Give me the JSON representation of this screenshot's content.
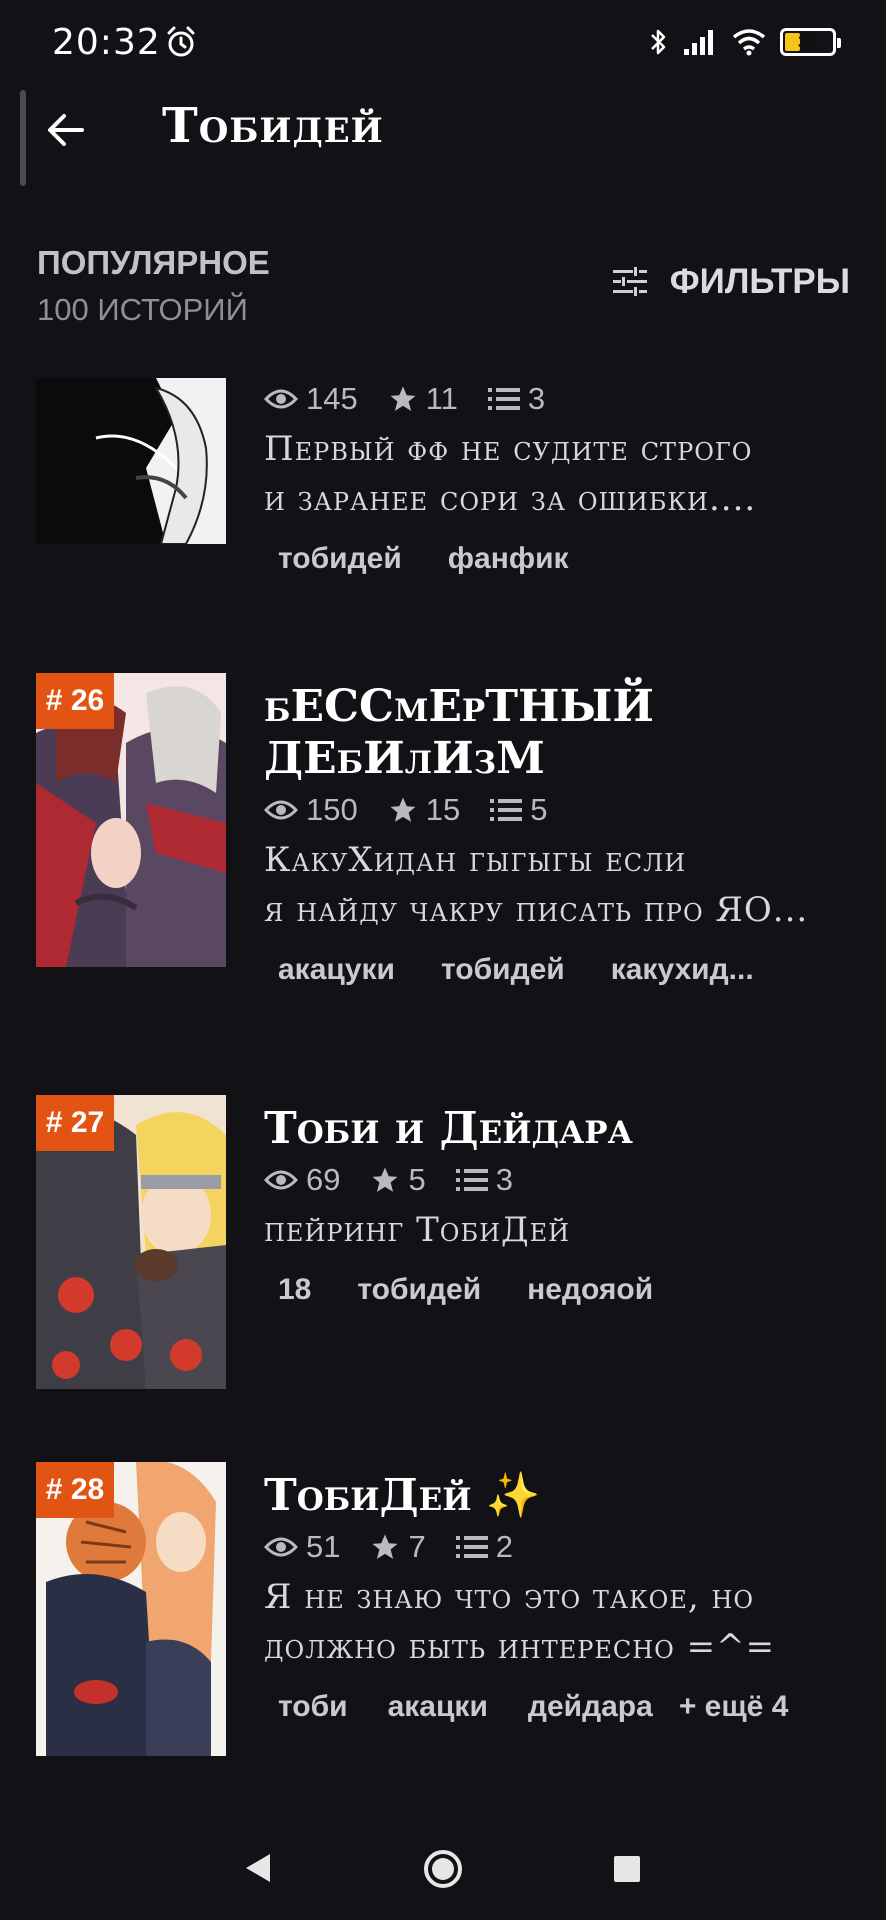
{
  "status_bar": {
    "time": "20:32",
    "battery": "33",
    "battery_level": 0.33,
    "icons": [
      "alarm-icon",
      "bluetooth-icon",
      "signal-icon",
      "wifi-icon",
      "battery-icon"
    ]
  },
  "header": {
    "title": "Тобидей",
    "back_icon": "arrow-left-icon"
  },
  "section": {
    "title": "ПОПУЛЯРНОЕ",
    "count": "100 ИСТОРИЙ",
    "filters_label": "ФИЛЬТРЫ",
    "filters_icon": "sliders-icon"
  },
  "colors": {
    "background": "#121115",
    "badge": "#e25414",
    "sparkle": "#f1c232"
  },
  "stories": [
    {
      "rank": "",
      "title": "",
      "views": "145",
      "stars": "11",
      "parts": "3",
      "desc_line1": "Первый фф не судите строго",
      "desc_line2": "и заранее сори за ошибки....",
      "tags": [
        "тобидей",
        "фанфик"
      ]
    },
    {
      "rank": "# 26",
      "title_line1": "бЕССмЕрТНЫЙ",
      "title_line2": "ДЕбИлИзМ",
      "views": "150",
      "stars": "15",
      "parts": "5",
      "desc_line1": "КакуХидан гыгыгы если",
      "desc_line2": "я найду чакру писать про ЯО...",
      "tags": [
        "акацуки",
        "тобидей",
        "какухид..."
      ]
    },
    {
      "rank": "# 27",
      "title": "Тоби и Дейдара",
      "views": "69",
      "stars": "5",
      "parts": "3",
      "desc_line1": "пейринг ТобиДей",
      "tags": [
        "18",
        "тобидей",
        "недояой"
      ]
    },
    {
      "rank": "# 28",
      "title": "ТобиДей",
      "sparkle": "✨",
      "views": "51",
      "stars": "7",
      "parts": "2",
      "desc_line1": "Я не знаю что это такое, но",
      "desc_line2": "должно быть интересно =^=",
      "tags": [
        "тоби",
        "акацки",
        "дейдара"
      ],
      "more_tags": "+ ещё 4"
    }
  ]
}
